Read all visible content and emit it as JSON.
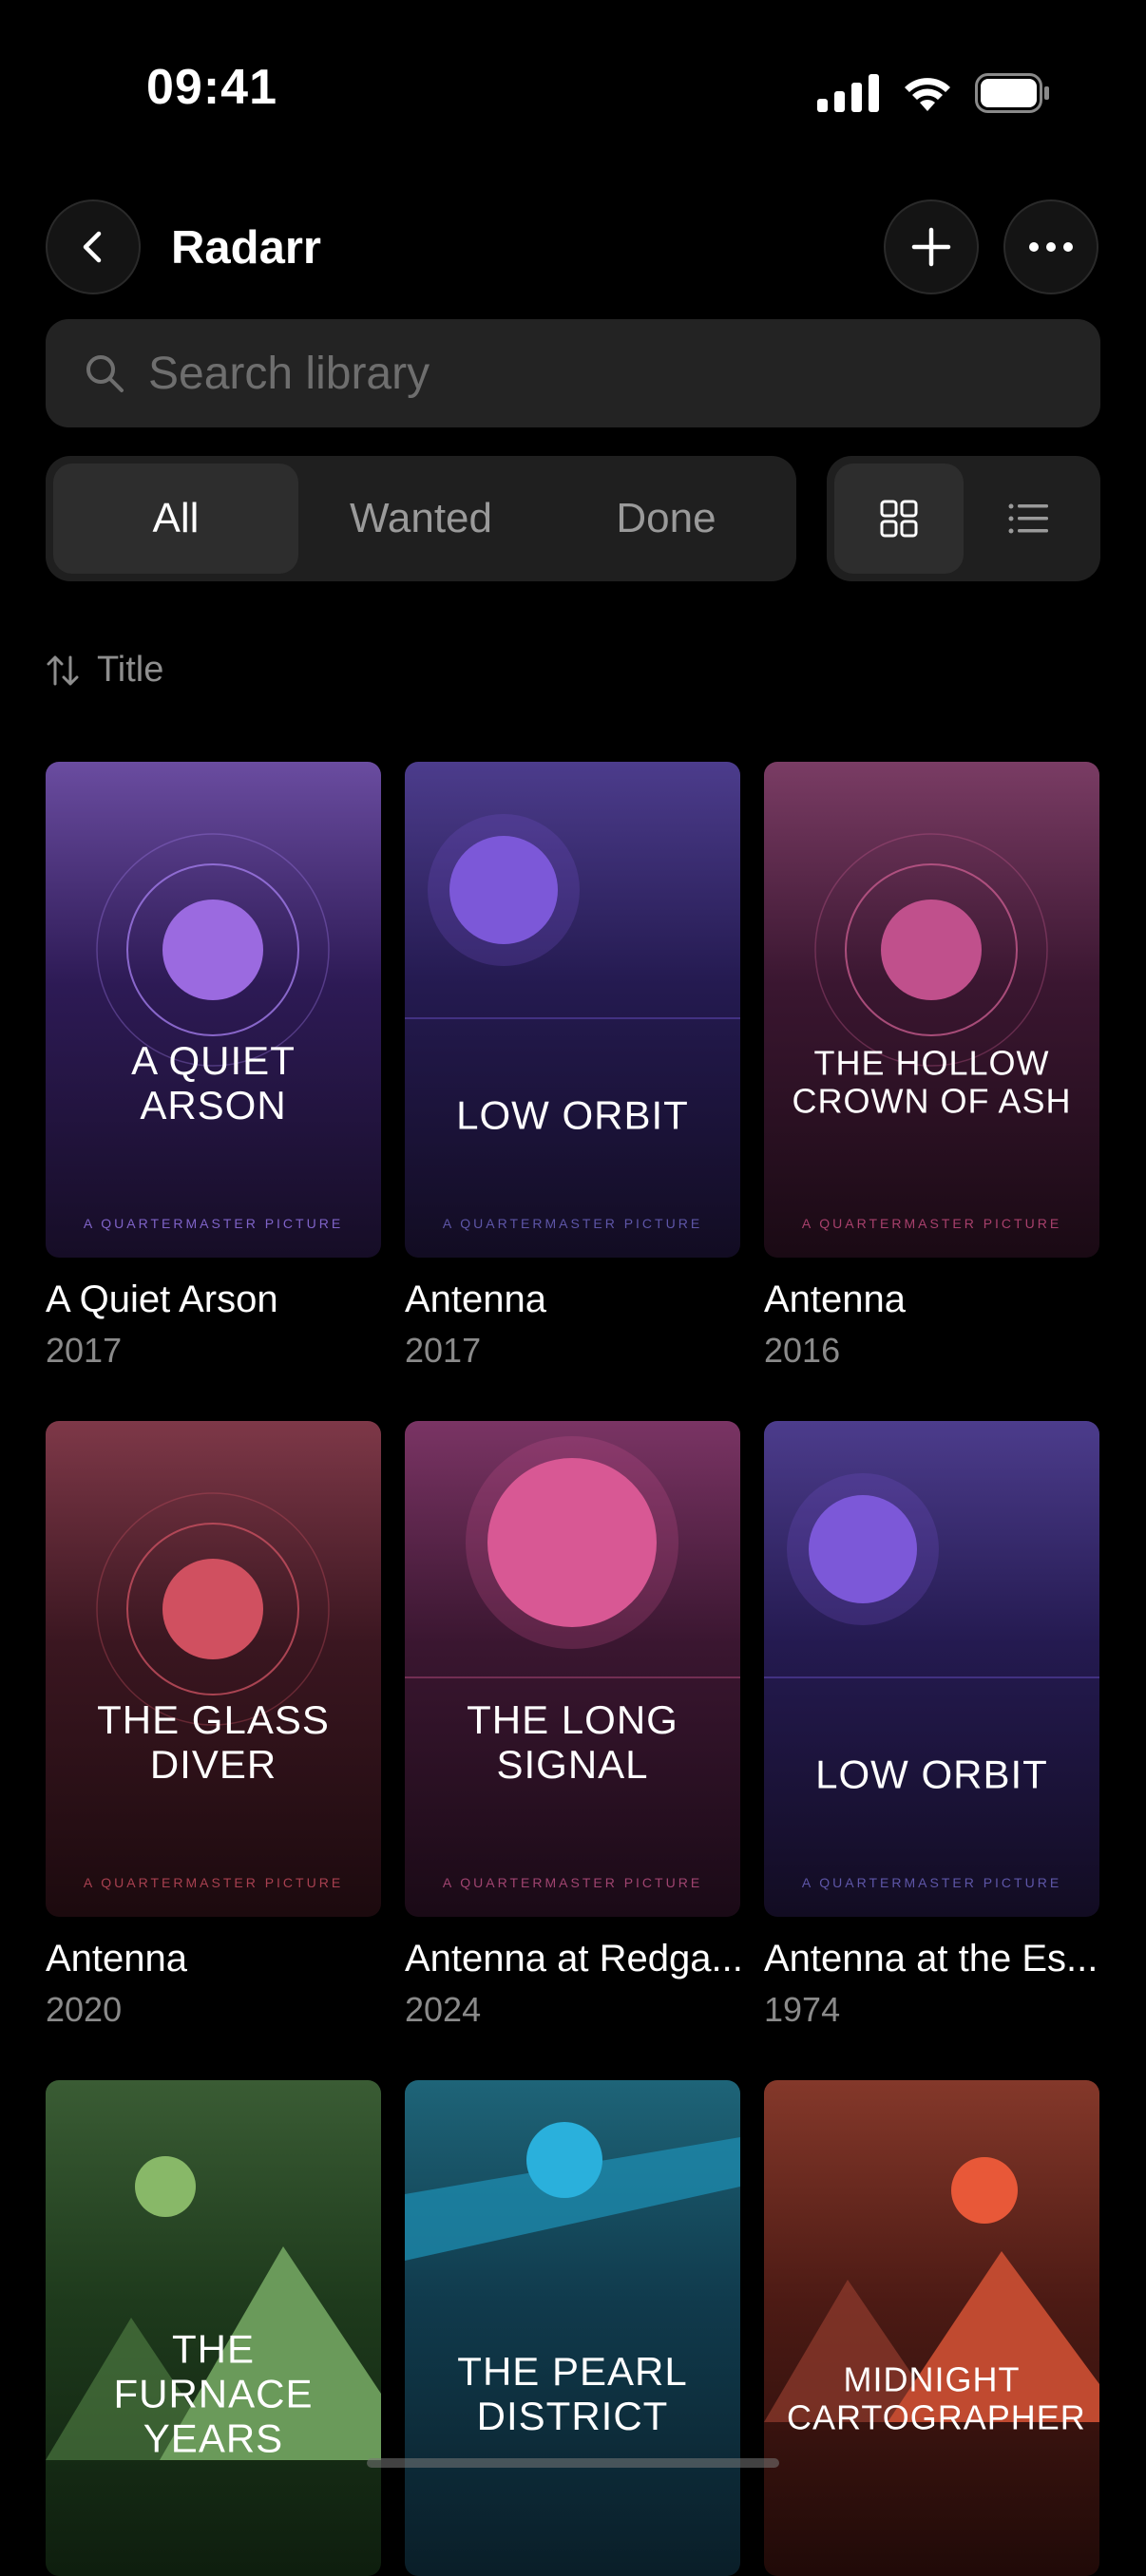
{
  "status_bar": {
    "time": "09:41"
  },
  "header": {
    "title": "Radarr"
  },
  "search": {
    "placeholder": "Search library"
  },
  "filters": {
    "options": [
      "All",
      "Wanted",
      "Done"
    ],
    "selected": "All"
  },
  "view_toggle": {
    "selected": "grid"
  },
  "sort": {
    "label": "Title"
  },
  "movies": [
    {
      "name": "A Quiet Arson",
      "year": "2017",
      "poster_title": "A QUIET ARSON",
      "studio": "A QUARTERMASTER PICTURE",
      "palette": "purple"
    },
    {
      "name": "Antenna",
      "year": "2017",
      "poster_title": "LOW ORBIT",
      "studio": "A QUARTERMASTER PICTURE",
      "palette": "indigo"
    },
    {
      "name": "Antenna",
      "year": "2016",
      "poster_title": "THE HOLLOW CROWN OF ASH",
      "studio": "A QUARTERMASTER PICTURE",
      "palette": "plum"
    },
    {
      "name": "Antenna",
      "year": "2020",
      "poster_title": "THE GLASS DIVER",
      "studio": "A QUARTERMASTER PICTURE",
      "palette": "crimson"
    },
    {
      "name": "Antenna at Redga...",
      "year": "2024",
      "poster_title": "THE LONG SIGNAL",
      "studio": "A QUARTERMASTER PICTURE",
      "palette": "magenta"
    },
    {
      "name": "Antenna at the Es...",
      "year": "1974",
      "poster_title": "LOW ORBIT",
      "studio": "A QUARTERMASTER PICTURE",
      "palette": "indigo"
    },
    {
      "name": "",
      "year": "",
      "poster_title": "THE FURNACE YEARS",
      "studio": "",
      "palette": "green"
    },
    {
      "name": "",
      "year": "",
      "poster_title": "THE PEARL DISTRICT",
      "studio": "",
      "palette": "teal"
    },
    {
      "name": "",
      "year": "",
      "poster_title": "MIDNIGHT CARTOGRAPHER",
      "studio": "",
      "palette": "orange"
    }
  ]
}
